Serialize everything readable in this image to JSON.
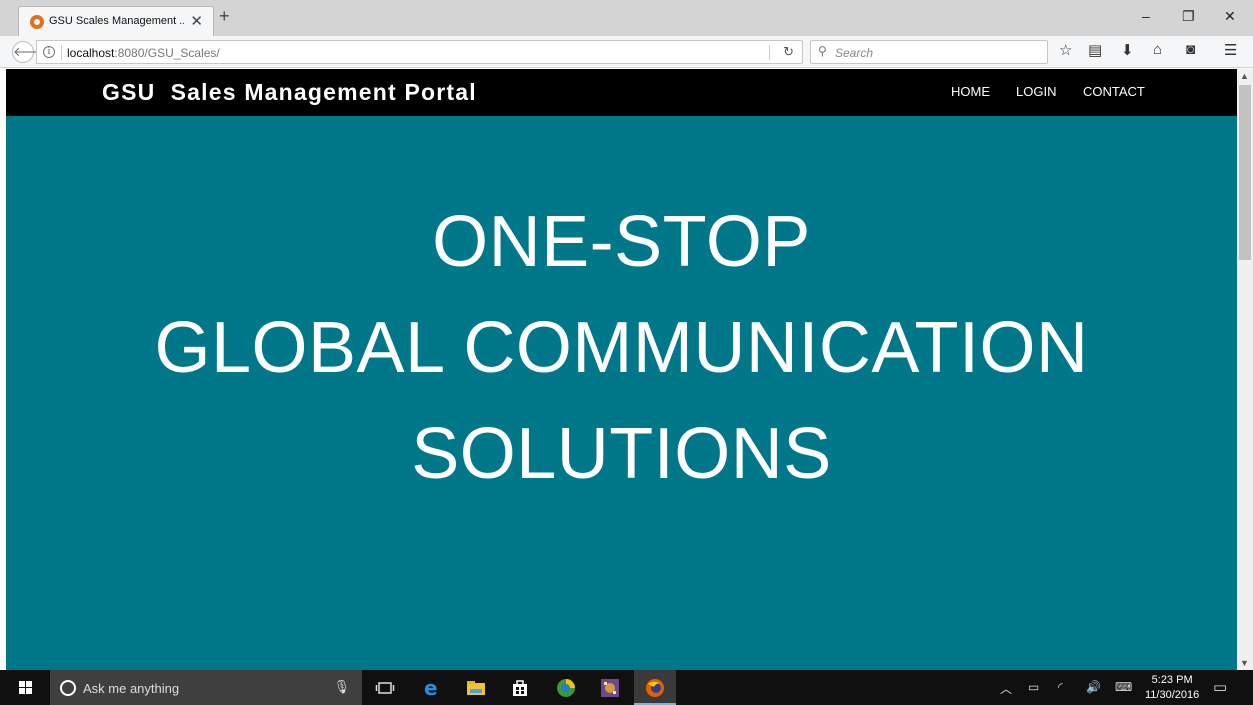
{
  "browser": {
    "tab_title": "GSU Scales Management ...",
    "url_host": "localhost",
    "url_path": ":8080/GSU_Scales/",
    "search_placeholder": "Search"
  },
  "site": {
    "brand": "GSU  Sales Management Portal",
    "nav": [
      "HOME",
      "LOGIN",
      "CONTACT"
    ],
    "hero_lines": [
      "ONE-STOP",
      "GLOBAL COMMUNICATION",
      "SOLUTIONS"
    ]
  },
  "taskbar": {
    "search_placeholder": "Ask me anything",
    "time": "5:23 PM",
    "date": "11/30/2016"
  },
  "colors": {
    "hero_bg": "#01788a",
    "header_bg": "#000000",
    "taskbar_bg": "#101010"
  },
  "icons": [
    "back-arrow-icon",
    "info-icon",
    "reload-icon",
    "search-icon",
    "star-icon",
    "reading-list-icon",
    "download-icon",
    "home-icon",
    "pocket-icon",
    "hamburger-menu-icon",
    "windows-start-icon",
    "cortana-icon",
    "microphone-icon",
    "task-view-icon",
    "edge-icon",
    "file-explorer-icon",
    "store-icon",
    "chrome-like-icon",
    "game-icon",
    "firefox-icon"
  ]
}
